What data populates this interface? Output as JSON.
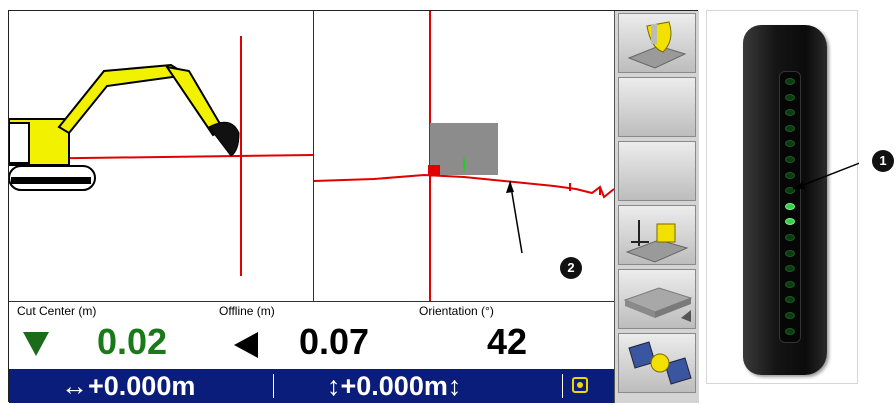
{
  "readouts": {
    "cut_center": {
      "label": "Cut Center (m)",
      "value": "0.02",
      "direction": "down-arrow-icon"
    },
    "offline": {
      "label": "Offline (m)",
      "value": "0.07",
      "direction": "left-arrow-icon"
    },
    "orientation": {
      "label": "Orientation (°)",
      "value": "42"
    }
  },
  "status_bar": {
    "horizontal": "↔+0.000m",
    "vertical": "↕+0.000m↕",
    "icon": "gps-status-icon"
  },
  "toolbar": {
    "buttons": [
      "bucket-view-icon",
      "",
      "",
      "excavator-settings-icon",
      "surface-grid-icon",
      "satellite-icon"
    ]
  },
  "device": {
    "led_count": 17,
    "lit": [
      8,
      9
    ]
  },
  "callouts": {
    "device": "1",
    "plan": "2"
  },
  "colors": {
    "status_bar": "#0b1d7a",
    "cut_value": "#1a7a1a",
    "design_line": "#e00000",
    "machine": "#f2f200"
  }
}
